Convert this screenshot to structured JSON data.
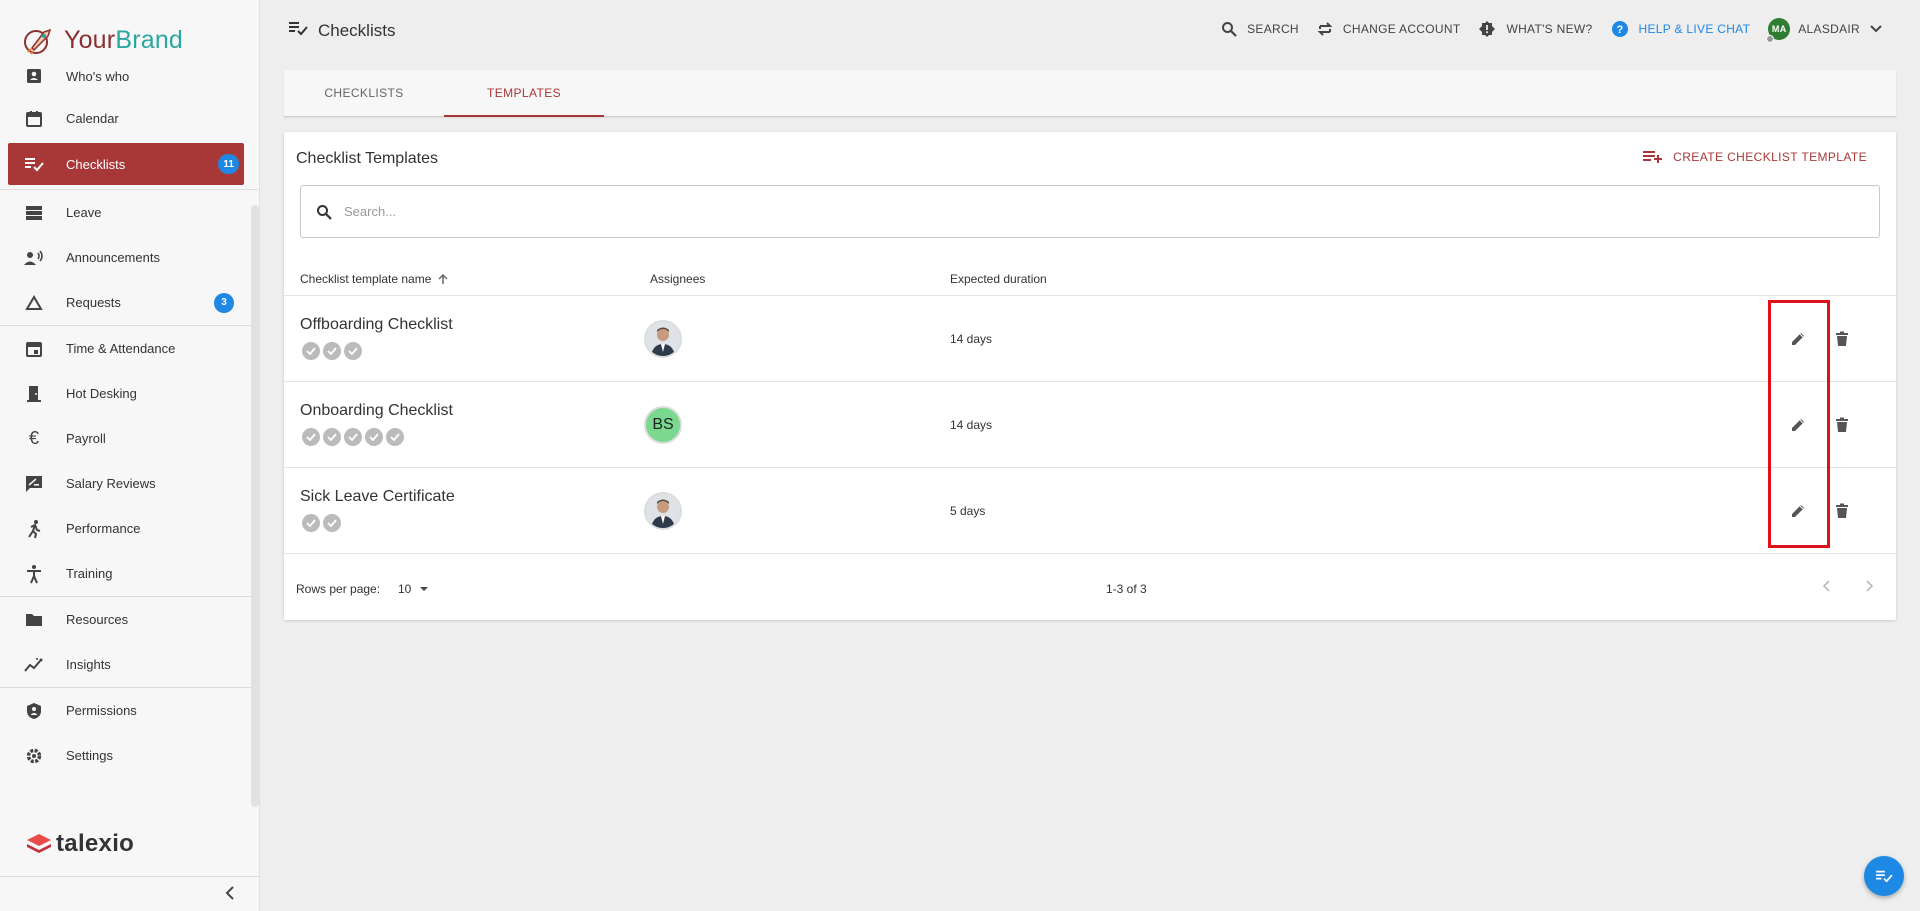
{
  "brand": {
    "your": "Your",
    "name": "Brand"
  },
  "sidebar": {
    "items": [
      {
        "label": "Who's who",
        "icon": "contact-card-icon"
      },
      {
        "label": "Calendar",
        "icon": "calendar-icon"
      },
      {
        "label": "Checklists",
        "icon": "checklist-icon",
        "badge": "11",
        "active": true
      },
      {
        "label": "Leave",
        "icon": "leave-icon"
      },
      {
        "label": "Announcements",
        "icon": "announcement-icon"
      },
      {
        "label": "Requests",
        "icon": "triangle-icon",
        "badge": "3"
      },
      {
        "label": "Time & Attendance",
        "icon": "calendar-event-icon"
      },
      {
        "label": "Hot Desking",
        "icon": "door-icon"
      },
      {
        "label": "Payroll",
        "icon": "euro-icon"
      },
      {
        "label": "Salary Reviews",
        "icon": "rate-review-icon"
      },
      {
        "label": "Performance",
        "icon": "running-icon"
      },
      {
        "label": "Training",
        "icon": "accessibility-icon"
      },
      {
        "label": "Resources",
        "icon": "folder-icon"
      },
      {
        "label": "Insights",
        "icon": "insights-icon"
      },
      {
        "label": "Permissions",
        "icon": "shield-icon"
      },
      {
        "label": "Settings",
        "icon": "gear-icon"
      }
    ],
    "footer_logo": "talexio"
  },
  "header": {
    "title": "Checklists",
    "search": "SEARCH",
    "change_account": "CHANGE ACCOUNT",
    "whats_new": "WHAT'S NEW?",
    "help": "HELP & LIVE CHAT",
    "user_initials": "MA",
    "user_name": "ALASDAIR"
  },
  "tabs": [
    {
      "label": "CHECKLISTS",
      "active": false
    },
    {
      "label": "TEMPLATES",
      "active": true
    }
  ],
  "card": {
    "title": "Checklist Templates",
    "create_label": "CREATE CHECKLIST TEMPLATE",
    "search_placeholder": "Search..."
  },
  "table": {
    "headers": [
      "Checklist template name",
      "Assignees",
      "Expected duration"
    ],
    "rows": [
      {
        "name": "Offboarding Checklist",
        "checks": 3,
        "assignee": {
          "type": "photo"
        },
        "duration": "14 days"
      },
      {
        "name": "Onboarding Checklist",
        "checks": 5,
        "assignee": {
          "type": "initials",
          "initials": "BS"
        },
        "duration": "14 days"
      },
      {
        "name": "Sick Leave Certificate",
        "checks": 2,
        "assignee": {
          "type": "photo"
        },
        "duration": "5 days"
      }
    ]
  },
  "pagination": {
    "rows_per_page_label": "Rows per page:",
    "rows_per_page": "10",
    "range": "1-3 of 3"
  },
  "colors": {
    "accent": "#a83838",
    "badge": "#1e88e5",
    "highlight": "#e0101a",
    "brand_teal": "#2ba6a0"
  }
}
